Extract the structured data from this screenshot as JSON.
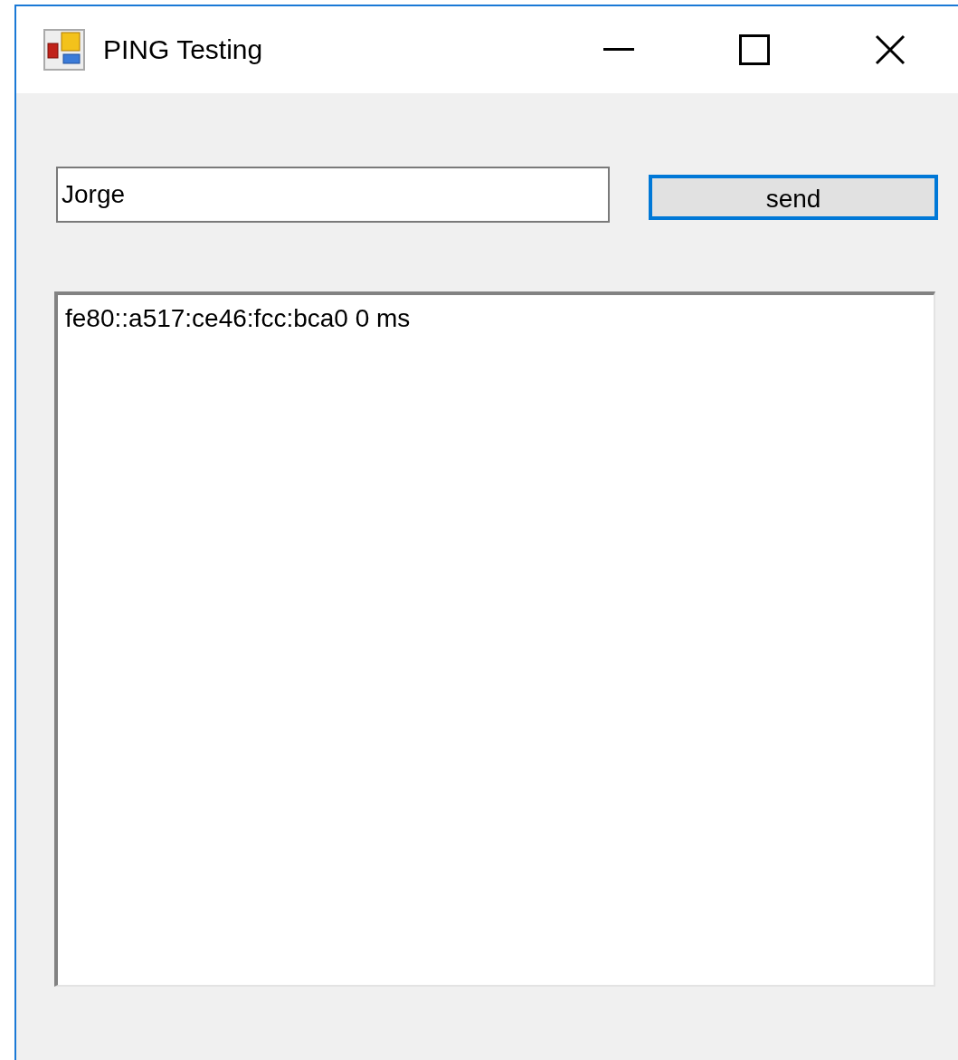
{
  "window": {
    "title": "PING Testing"
  },
  "host_field": {
    "value": "Jorge"
  },
  "send_button": {
    "label": "send",
    "focused": true
  },
  "results_list": {
    "items": [
      "fe80::a517:ce46:fcc:bca0 0 ms"
    ]
  }
}
